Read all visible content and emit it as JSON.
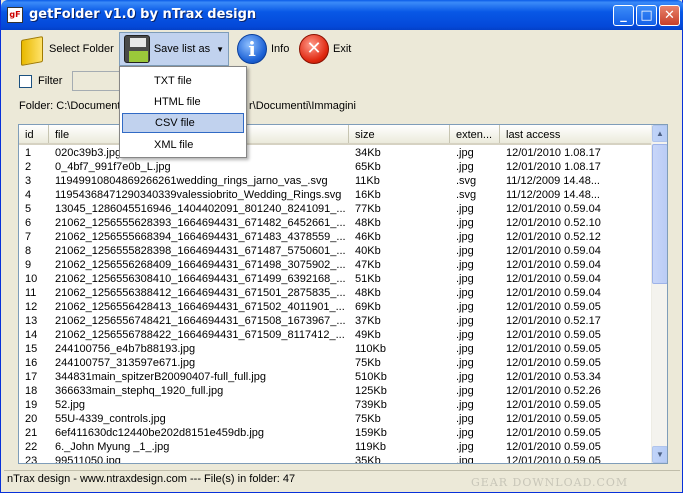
{
  "window": {
    "title": "getFolder v1.0 by nTrax design",
    "app_icon": "gF"
  },
  "titlebar_buttons": {
    "minimize": "_",
    "maximize": "□",
    "close": "✕"
  },
  "toolbar": {
    "select_folder": "Select Folder",
    "save_list_as": "Save list as",
    "dropdown_arrow": "▼",
    "info": "Info",
    "info_glyph": "i",
    "exit": "Exit",
    "exit_glyph": "✕"
  },
  "filter": {
    "label": "Filter",
    "checked": false,
    "value": ""
  },
  "folder": {
    "label_visible": "Folder: C:\\Document",
    "tail_visible": "r\\Documenti\\Immagini"
  },
  "save_menu": {
    "items": [
      "TXT file",
      "HTML file",
      "CSV file",
      "XML file"
    ],
    "selected": "CSV file"
  },
  "list": {
    "columns": [
      "id",
      "file",
      "size",
      "exten...",
      "last access"
    ],
    "rows": [
      [
        "1",
        "020c39b3.jpg",
        "34Kb",
        ".jpg",
        "12/01/2010 1.08.17"
      ],
      [
        "2",
        "0_4bf7_991f7e0b_L.jpg",
        "65Kb",
        ".jpg",
        "12/01/2010 1.08.17"
      ],
      [
        "3",
        "11949910804869266261wedding_rings_jarno_vas_.svg",
        "11Kb",
        ".svg",
        "11/12/2009 14.48..."
      ],
      [
        "4",
        "11954368471290340339valessiobrito_Wedding_Rings.svg",
        "16Kb",
        ".svg",
        "11/12/2009 14.48..."
      ],
      [
        "5",
        "13045_1286045516946_1404402091_801240_8241091_...",
        "77Kb",
        ".jpg",
        "12/01/2010 0.59.04"
      ],
      [
        "6",
        "21062_1256555628393_1664694431_671482_6452661_...",
        "48Kb",
        ".jpg",
        "12/01/2010 0.52.10"
      ],
      [
        "7",
        "21062_1256555668394_1664694431_671483_4378559_...",
        "46Kb",
        ".jpg",
        "12/01/2010 0.52.12"
      ],
      [
        "8",
        "21062_1256555828398_1664694431_671487_5750601_...",
        "40Kb",
        ".jpg",
        "12/01/2010 0.59.04"
      ],
      [
        "9",
        "21062_1256556268409_1664694431_671498_3075902_...",
        "47Kb",
        ".jpg",
        "12/01/2010 0.59.04"
      ],
      [
        "10",
        "21062_1256556308410_1664694431_671499_6392168_...",
        "51Kb",
        ".jpg",
        "12/01/2010 0.59.04"
      ],
      [
        "11",
        "21062_1256556388412_1664694431_671501_2875835_...",
        "48Kb",
        ".jpg",
        "12/01/2010 0.59.04"
      ],
      [
        "12",
        "21062_1256556428413_1664694431_671502_4011901_...",
        "69Kb",
        ".jpg",
        "12/01/2010 0.59.05"
      ],
      [
        "13",
        "21062_1256556748421_1664694431_671508_1673967_...",
        "37Kb",
        ".jpg",
        "12/01/2010 0.52.17"
      ],
      [
        "14",
        "21062_1256556788422_1664694431_671509_8117412_...",
        "49Kb",
        ".jpg",
        "12/01/2010 0.59.05"
      ],
      [
        "15",
        "244100756_e4b7b88193.jpg",
        "110Kb",
        ".jpg",
        "12/01/2010 0.59.05"
      ],
      [
        "16",
        "244100757_313597e671.jpg",
        "75Kb",
        ".jpg",
        "12/01/2010 0.59.05"
      ],
      [
        "17",
        "344831main_spitzerB20090407-full_full.jpg",
        "510Kb",
        ".jpg",
        "12/01/2010 0.53.34"
      ],
      [
        "18",
        "366633main_stephq_1920_full.jpg",
        "125Kb",
        ".jpg",
        "12/01/2010 0.52.26"
      ],
      [
        "19",
        "52.jpg",
        "739Kb",
        ".jpg",
        "12/01/2010 0.59.05"
      ],
      [
        "20",
        "55U-4339_controls.jpg",
        "75Kb",
        ".jpg",
        "12/01/2010 0.59.05"
      ],
      [
        "21",
        "6ef411630dc12440be202d8151e459db.jpg",
        "159Kb",
        ".jpg",
        "12/01/2010 0.59.05"
      ],
      [
        "22",
        "6._John Myung _1_.jpg",
        "119Kb",
        ".jpg",
        "12/01/2010 0.59.05"
      ],
      [
        "23",
        "99511050.jpg",
        "35Kb",
        ".jpg",
        "12/01/2010 0.59.05"
      ]
    ]
  },
  "scrollbar": {
    "up": "▲",
    "down": "▼",
    "position_fraction": 0.0
  },
  "statusbar": {
    "text": "nTrax design - www.ntraxdesign.com --- File(s) in folder: 47"
  },
  "watermark": {
    "text": "GEAR DOWNLOAD.COM"
  }
}
